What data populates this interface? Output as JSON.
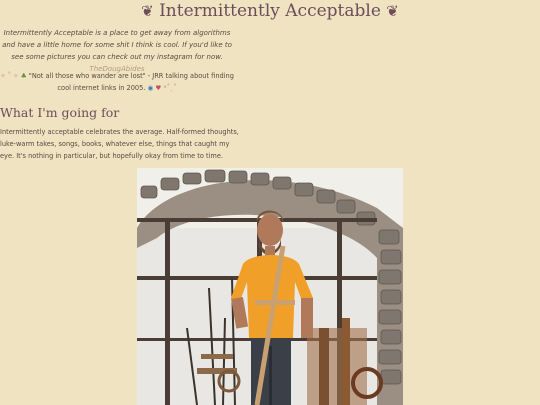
{
  "header": {
    "fleuron": "❦",
    "title": "Intermittently Acceptable"
  },
  "intro": {
    "text": "Intermittently Acceptable is a place to get away from algorithms and have a little home for some shit I think is cool. If you'd like to see some pictures you can check out my instagram for now.",
    "link_text": "TheDougAbides"
  },
  "quote": {
    "sparkle_left": "✧ ˚ ✧",
    "clover": "♣",
    "text": "\"Not all those who wander are lost\" - JRR talking about finding cool internet links in 2005.",
    "globe": "◉",
    "heart": "♥",
    "sparkle_right": "*˚ˎ˚"
  },
  "section": {
    "heading": "What I'm going for",
    "body": "Intermittently acceptable celebrates the average. Half-formed thoughts, luke-warm takes, songs, books, whatever else, things that caught my eye. It's nothing in particular, but hopefully okay from time to time."
  },
  "colors": {
    "background": "#efe3c1",
    "heading": "#6b4e5a",
    "text": "#5a4a42",
    "link": "#b79a7e"
  }
}
